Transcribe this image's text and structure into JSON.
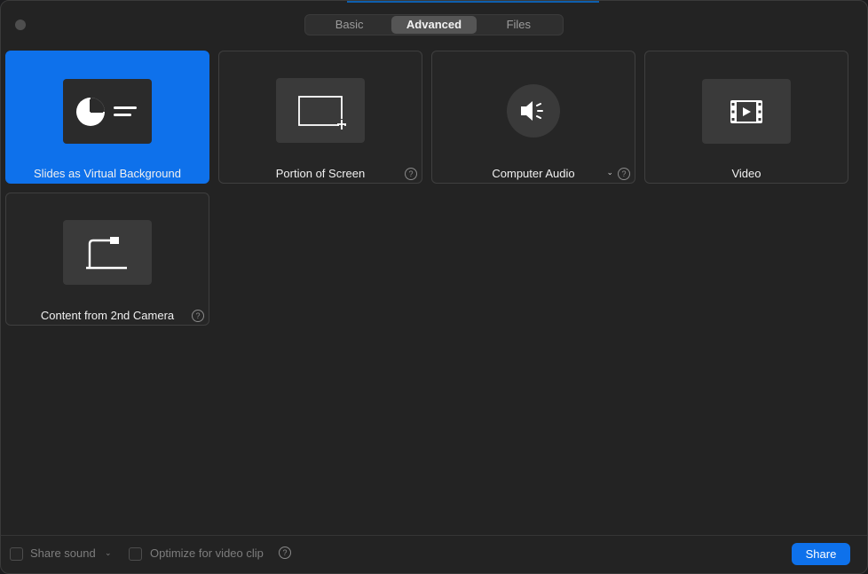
{
  "tabs": [
    {
      "label": "Basic",
      "active": false
    },
    {
      "label": "Advanced",
      "active": true
    },
    {
      "label": "Files",
      "active": false
    }
  ],
  "tiles": [
    {
      "label": "Slides as Virtual Background",
      "icon": "slides-icon",
      "selected": true
    },
    {
      "label": "Portion of Screen",
      "icon": "screen-portion-icon",
      "help": "?"
    },
    {
      "label": "Computer Audio",
      "icon": "speaker-icon",
      "caret": "⌄",
      "help": "?"
    },
    {
      "label": "Video",
      "icon": "film-icon"
    },
    {
      "label": "Content from 2nd Camera",
      "icon": "document-camera-icon",
      "help": "?"
    }
  ],
  "footer": {
    "share_sound_label": "Share sound",
    "share_sound_caret": "⌄",
    "optimize_label": "Optimize for video clip",
    "optimize_help": "?",
    "share_button_label": "Share"
  },
  "colors": {
    "accent": "#0e71eb",
    "background": "#232323"
  }
}
